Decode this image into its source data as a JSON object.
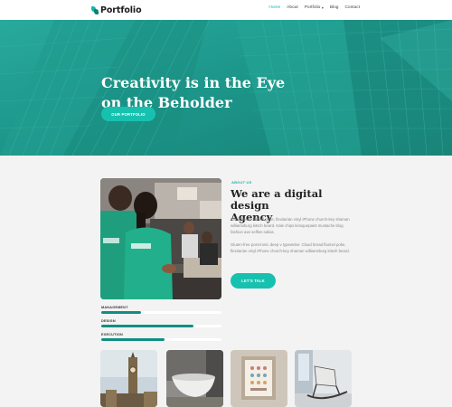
{
  "brand": {
    "name": "Portfolio",
    "accent": "#17c1af"
  },
  "nav": {
    "items": [
      {
        "label": "Home",
        "active": true
      },
      {
        "label": "About",
        "active": false
      },
      {
        "label": "Portfolio",
        "active": false,
        "dropdown": true
      },
      {
        "label": "Blog",
        "active": false
      },
      {
        "label": "Contact",
        "active": false
      }
    ],
    "caret_icon": "chevron-down-icon"
  },
  "hero": {
    "title_line1": "Creativity is in the Eye",
    "title_line2": "on the Beholder",
    "button_label": "OUR PORTFOLIO"
  },
  "about": {
    "label": "ABOUT US",
    "title_line1": "We are a digital design",
    "title_line2": "Agency",
    "paragraph1": "Cloud bread flannel poke, flexitarian vinyl iPhone church-key shaman williamsburg kitsch beard. Kale chips kinsquepaint mustache blog fashion axe selfies salvia.",
    "paragraph2": "Gluten-free post-ironic deep v typewriter. Cloud bread flannel poke, flexitarian vinyl iPhone church-key shaman williamsburg kitsch beard.",
    "button_label": "LET'S TALK"
  },
  "skills": [
    {
      "label": "MANAGEMENT",
      "level": 0.33
    },
    {
      "label": "DESIGN",
      "level": 0.77
    },
    {
      "label": "EXECUTION",
      "level": 0.53
    }
  ],
  "gallery": [
    "clock-tower-photo",
    "bathtub-photo",
    "framed-art-photo",
    "rocking-chair-photo"
  ]
}
